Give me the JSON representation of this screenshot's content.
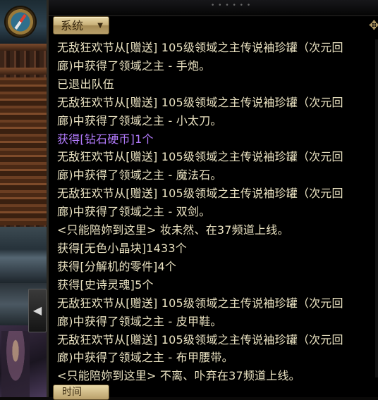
{
  "chat": {
    "channel_tab": "系统",
    "bottom_tab": "时间",
    "lines": [
      {
        "text": "无敌狂欢节从[赠送] 105级领域之主传说袖珍罐（次元回",
        "color": "normal"
      },
      {
        "text": "廊)中获得了领域之主 - 手炮。",
        "color": "normal"
      },
      {
        "text": "已退出队伍",
        "color": "normal"
      },
      {
        "text": "无敌狂欢节从[赠送] 105级领域之主传说袖珍罐（次元回",
        "color": "normal"
      },
      {
        "text": "廊)中获得了领域之主 - 小太刀。",
        "color": "normal"
      },
      {
        "text": "获得[钻石硬币]1个",
        "color": "purple"
      },
      {
        "text": "无敌狂欢节从[赠送] 105级领域之主传说袖珍罐（次元回",
        "color": "normal"
      },
      {
        "text": "廊)中获得了领域之主 - 魔法石。",
        "color": "normal"
      },
      {
        "text": "无敌狂欢节从[赠送] 105级领域之主传说袖珍罐（次元回",
        "color": "normal"
      },
      {
        "text": "廊)中获得了领域之主 - 双剑。",
        "color": "normal"
      },
      {
        "text": "<只能陪妳到这里> 妆未然、在37频道上线。",
        "color": "normal"
      },
      {
        "text": "获得[无色小晶块]1433个",
        "color": "normal"
      },
      {
        "text": "获得[分解机的零件]4个",
        "color": "normal"
      },
      {
        "text": "获得[史诗灵魂]5个",
        "color": "normal"
      },
      {
        "text": "无敌狂欢节从[赠送] 105级领域之主传说袖珍罐（次元回",
        "color": "normal"
      },
      {
        "text": "廊)中获得了领域之主 - 皮甲鞋。",
        "color": "normal"
      },
      {
        "text": "无敌狂欢节从[赠送] 105级领域之主传说袖珍罐（次元回",
        "color": "normal"
      },
      {
        "text": "廊)中获得了领域之主 - 布甲腰带。",
        "color": "normal"
      },
      {
        "text": "<只能陪妳到这里> 不离、卟弃在37频道上线。",
        "color": "normal"
      }
    ]
  },
  "icons": {
    "compass": "minimap-compass-icon",
    "side_arrow": "◀",
    "caret": "▼",
    "gear": "✥"
  },
  "colors": {
    "text": "#ebe3c2",
    "purple_item": "#b47cff",
    "tab_gold": "#c8b079"
  }
}
